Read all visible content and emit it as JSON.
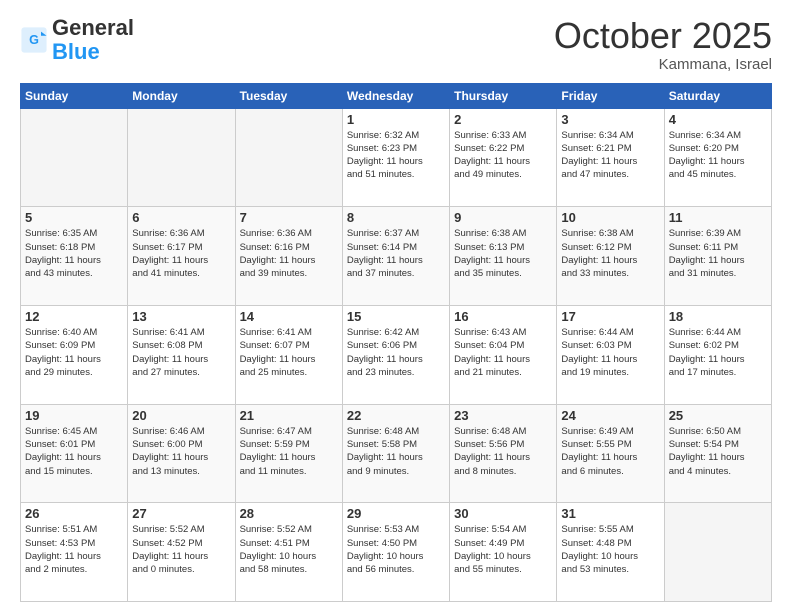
{
  "header": {
    "logo_general": "General",
    "logo_blue": "Blue",
    "month": "October 2025",
    "location": "Kammana, Israel"
  },
  "days_of_week": [
    "Sunday",
    "Monday",
    "Tuesday",
    "Wednesday",
    "Thursday",
    "Friday",
    "Saturday"
  ],
  "weeks": [
    [
      {
        "day": "",
        "info": ""
      },
      {
        "day": "",
        "info": ""
      },
      {
        "day": "",
        "info": ""
      },
      {
        "day": "1",
        "info": "Sunrise: 6:32 AM\nSunset: 6:23 PM\nDaylight: 11 hours\nand 51 minutes."
      },
      {
        "day": "2",
        "info": "Sunrise: 6:33 AM\nSunset: 6:22 PM\nDaylight: 11 hours\nand 49 minutes."
      },
      {
        "day": "3",
        "info": "Sunrise: 6:34 AM\nSunset: 6:21 PM\nDaylight: 11 hours\nand 47 minutes."
      },
      {
        "day": "4",
        "info": "Sunrise: 6:34 AM\nSunset: 6:20 PM\nDaylight: 11 hours\nand 45 minutes."
      }
    ],
    [
      {
        "day": "5",
        "info": "Sunrise: 6:35 AM\nSunset: 6:18 PM\nDaylight: 11 hours\nand 43 minutes."
      },
      {
        "day": "6",
        "info": "Sunrise: 6:36 AM\nSunset: 6:17 PM\nDaylight: 11 hours\nand 41 minutes."
      },
      {
        "day": "7",
        "info": "Sunrise: 6:36 AM\nSunset: 6:16 PM\nDaylight: 11 hours\nand 39 minutes."
      },
      {
        "day": "8",
        "info": "Sunrise: 6:37 AM\nSunset: 6:14 PM\nDaylight: 11 hours\nand 37 minutes."
      },
      {
        "day": "9",
        "info": "Sunrise: 6:38 AM\nSunset: 6:13 PM\nDaylight: 11 hours\nand 35 minutes."
      },
      {
        "day": "10",
        "info": "Sunrise: 6:38 AM\nSunset: 6:12 PM\nDaylight: 11 hours\nand 33 minutes."
      },
      {
        "day": "11",
        "info": "Sunrise: 6:39 AM\nSunset: 6:11 PM\nDaylight: 11 hours\nand 31 minutes."
      }
    ],
    [
      {
        "day": "12",
        "info": "Sunrise: 6:40 AM\nSunset: 6:09 PM\nDaylight: 11 hours\nand 29 minutes."
      },
      {
        "day": "13",
        "info": "Sunrise: 6:41 AM\nSunset: 6:08 PM\nDaylight: 11 hours\nand 27 minutes."
      },
      {
        "day": "14",
        "info": "Sunrise: 6:41 AM\nSunset: 6:07 PM\nDaylight: 11 hours\nand 25 minutes."
      },
      {
        "day": "15",
        "info": "Sunrise: 6:42 AM\nSunset: 6:06 PM\nDaylight: 11 hours\nand 23 minutes."
      },
      {
        "day": "16",
        "info": "Sunrise: 6:43 AM\nSunset: 6:04 PM\nDaylight: 11 hours\nand 21 minutes."
      },
      {
        "day": "17",
        "info": "Sunrise: 6:44 AM\nSunset: 6:03 PM\nDaylight: 11 hours\nand 19 minutes."
      },
      {
        "day": "18",
        "info": "Sunrise: 6:44 AM\nSunset: 6:02 PM\nDaylight: 11 hours\nand 17 minutes."
      }
    ],
    [
      {
        "day": "19",
        "info": "Sunrise: 6:45 AM\nSunset: 6:01 PM\nDaylight: 11 hours\nand 15 minutes."
      },
      {
        "day": "20",
        "info": "Sunrise: 6:46 AM\nSunset: 6:00 PM\nDaylight: 11 hours\nand 13 minutes."
      },
      {
        "day": "21",
        "info": "Sunrise: 6:47 AM\nSunset: 5:59 PM\nDaylight: 11 hours\nand 11 minutes."
      },
      {
        "day": "22",
        "info": "Sunrise: 6:48 AM\nSunset: 5:58 PM\nDaylight: 11 hours\nand 9 minutes."
      },
      {
        "day": "23",
        "info": "Sunrise: 6:48 AM\nSunset: 5:56 PM\nDaylight: 11 hours\nand 8 minutes."
      },
      {
        "day": "24",
        "info": "Sunrise: 6:49 AM\nSunset: 5:55 PM\nDaylight: 11 hours\nand 6 minutes."
      },
      {
        "day": "25",
        "info": "Sunrise: 6:50 AM\nSunset: 5:54 PM\nDaylight: 11 hours\nand 4 minutes."
      }
    ],
    [
      {
        "day": "26",
        "info": "Sunrise: 5:51 AM\nSunset: 4:53 PM\nDaylight: 11 hours\nand 2 minutes."
      },
      {
        "day": "27",
        "info": "Sunrise: 5:52 AM\nSunset: 4:52 PM\nDaylight: 11 hours\nand 0 minutes."
      },
      {
        "day": "28",
        "info": "Sunrise: 5:52 AM\nSunset: 4:51 PM\nDaylight: 10 hours\nand 58 minutes."
      },
      {
        "day": "29",
        "info": "Sunrise: 5:53 AM\nSunset: 4:50 PM\nDaylight: 10 hours\nand 56 minutes."
      },
      {
        "day": "30",
        "info": "Sunrise: 5:54 AM\nSunset: 4:49 PM\nDaylight: 10 hours\nand 55 minutes."
      },
      {
        "day": "31",
        "info": "Sunrise: 5:55 AM\nSunset: 4:48 PM\nDaylight: 10 hours\nand 53 minutes."
      },
      {
        "day": "",
        "info": ""
      }
    ]
  ]
}
